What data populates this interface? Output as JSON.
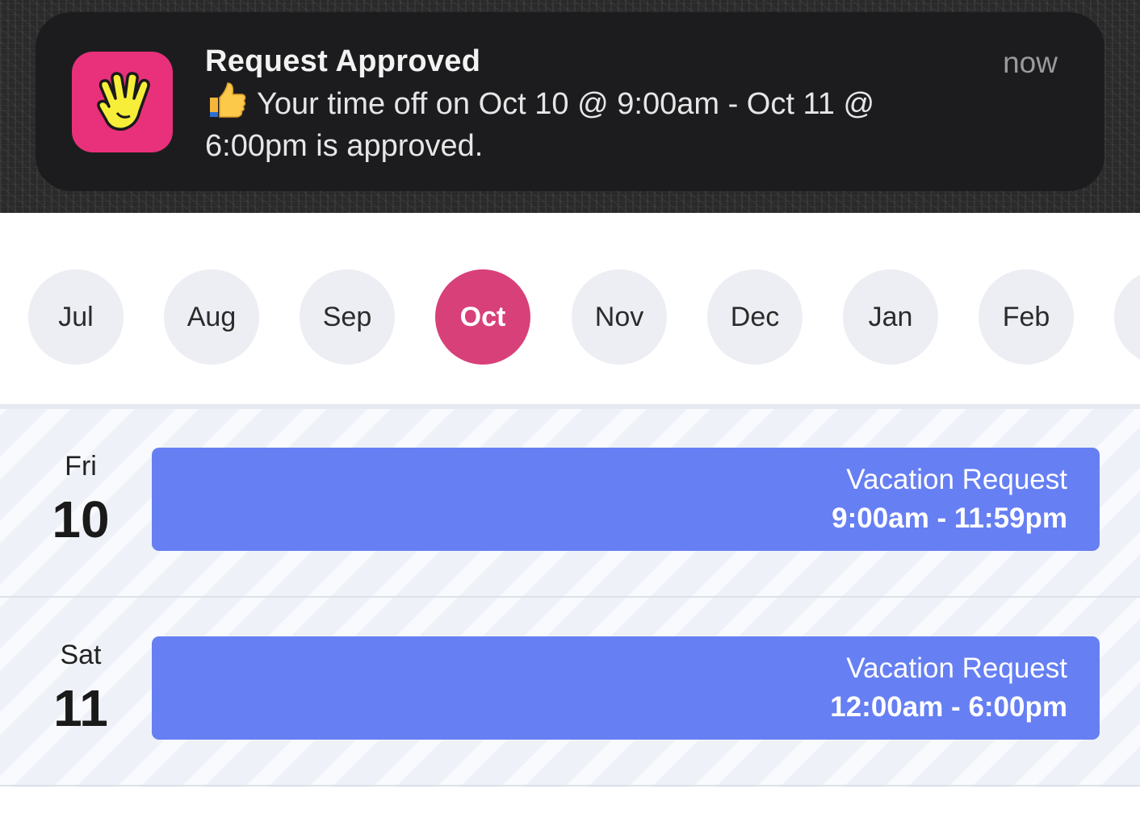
{
  "notification": {
    "app_icon": "vulcan-salute-icon",
    "title": "Request Approved",
    "body": "Your time off on Oct 10 @ 9:00am - Oct 11 @ 6:00pm is approved.",
    "body_icon": "thumbs-up-icon",
    "time": "now",
    "accent": "#e8317a"
  },
  "months": {
    "items": [
      "Jul",
      "Aug",
      "Sep",
      "Oct",
      "Nov",
      "Dec",
      "Jan",
      "Feb"
    ],
    "selected": "Oct",
    "selected_color": "#d8407a"
  },
  "calendar": {
    "event_color": "#667ff3",
    "days": [
      {
        "weekday": "Fri",
        "day": "10",
        "event_title": "Vacation Request",
        "event_time": "9:00am - 11:59pm"
      },
      {
        "weekday": "Sat",
        "day": "11",
        "event_title": "Vacation Request",
        "event_time": "12:00am - 6:00pm"
      }
    ]
  }
}
